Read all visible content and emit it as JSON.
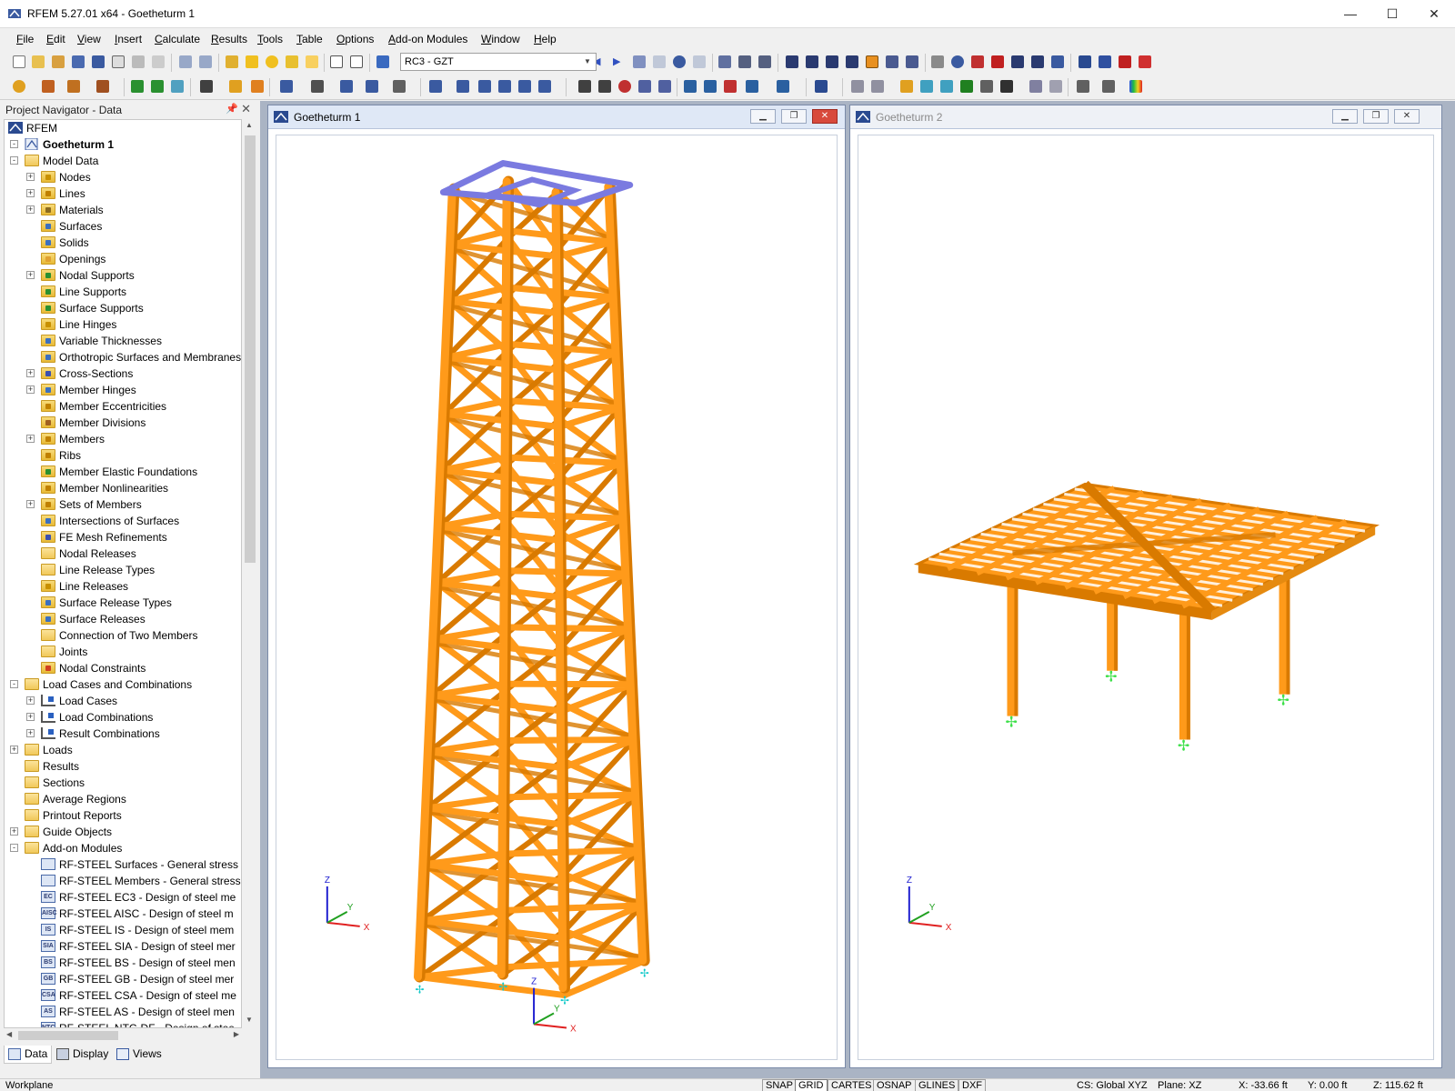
{
  "window": {
    "title": "RFEM 5.27.01 x64 - Goetheturm 1",
    "min_glyph": "—",
    "max_glyph": "☐",
    "close_glyph": "✕"
  },
  "menu": [
    "File",
    "Edit",
    "View",
    "Insert",
    "Calculate",
    "Results",
    "Tools",
    "Table",
    "Options",
    "Add-on Modules",
    "Window",
    "Help"
  ],
  "toolbar": {
    "load_case": "RC3 - GZT"
  },
  "navigator": {
    "title": "Project Navigator - Data",
    "root": "RFEM",
    "project": "Goetheturm 1",
    "items": [
      {
        "label": "Model Data",
        "level": 1,
        "exp": "-",
        "icon": "folder"
      },
      {
        "label": "Nodes",
        "level": 2,
        "exp": "+",
        "icon": "folder",
        "dot": "#c89000"
      },
      {
        "label": "Lines",
        "level": 2,
        "exp": "+",
        "icon": "folder",
        "dot": "#c08000"
      },
      {
        "label": "Materials",
        "level": 2,
        "exp": "+",
        "icon": "folder",
        "dot": "#8a6a20"
      },
      {
        "label": "Surfaces",
        "level": 2,
        "exp": "",
        "icon": "folder",
        "dot": "#3a70c0"
      },
      {
        "label": "Solids",
        "level": 2,
        "exp": "",
        "icon": "folder",
        "dot": "#3a70c0"
      },
      {
        "label": "Openings",
        "level": 2,
        "exp": "",
        "icon": "folder",
        "dot": "#e0a030"
      },
      {
        "label": "Nodal Supports",
        "level": 2,
        "exp": "+",
        "icon": "folder",
        "dot": "#2a9030"
      },
      {
        "label": "Line Supports",
        "level": 2,
        "exp": "",
        "icon": "folder",
        "dot": "#2a9030"
      },
      {
        "label": "Surface Supports",
        "level": 2,
        "exp": "",
        "icon": "folder",
        "dot": "#2a9030"
      },
      {
        "label": "Line Hinges",
        "level": 2,
        "exp": "",
        "icon": "folder",
        "dot": "#c89000"
      },
      {
        "label": "Variable Thicknesses",
        "level": 2,
        "exp": "",
        "icon": "folder",
        "dot": "#3a70c0"
      },
      {
        "label": "Orthotropic Surfaces and Membranes",
        "level": 2,
        "exp": "",
        "icon": "folder",
        "dot": "#3a70c0"
      },
      {
        "label": "Cross-Sections",
        "level": 2,
        "exp": "+",
        "icon": "folder",
        "dot": "#3a50b0"
      },
      {
        "label": "Member Hinges",
        "level": 2,
        "exp": "+",
        "icon": "folder",
        "dot": "#3a70c0"
      },
      {
        "label": "Member Eccentricities",
        "level": 2,
        "exp": "",
        "icon": "folder",
        "dot": "#c08000"
      },
      {
        "label": "Member Divisions",
        "level": 2,
        "exp": "",
        "icon": "folder",
        "dot": "#a06020"
      },
      {
        "label": "Members",
        "level": 2,
        "exp": "+",
        "icon": "folder",
        "dot": "#c08000"
      },
      {
        "label": "Ribs",
        "level": 2,
        "exp": "",
        "icon": "folder",
        "dot": "#c08000"
      },
      {
        "label": "Member Elastic Foundations",
        "level": 2,
        "exp": "",
        "icon": "folder",
        "dot": "#2a9030"
      },
      {
        "label": "Member Nonlinearities",
        "level": 2,
        "exp": "",
        "icon": "folder",
        "dot": "#c08000"
      },
      {
        "label": "Sets of Members",
        "level": 2,
        "exp": "+",
        "icon": "folder",
        "dot": "#c08000"
      },
      {
        "label": "Intersections of Surfaces",
        "level": 2,
        "exp": "",
        "icon": "folder",
        "dot": "#3a70c0"
      },
      {
        "label": "FE Mesh Refinements",
        "level": 2,
        "exp": "",
        "icon": "folder",
        "dot": "#3a50b0"
      },
      {
        "label": "Nodal Releases",
        "level": 2,
        "exp": "",
        "icon": "folder",
        "dot": ""
      },
      {
        "label": "Line Release Types",
        "level": 2,
        "exp": "",
        "icon": "folder",
        "dot": ""
      },
      {
        "label": "Line Releases",
        "level": 2,
        "exp": "",
        "icon": "folder",
        "dot": "#c89000"
      },
      {
        "label": "Surface Release Types",
        "level": 2,
        "exp": "",
        "icon": "folder",
        "dot": "#3a70c0"
      },
      {
        "label": "Surface Releases",
        "level": 2,
        "exp": "",
        "icon": "folder",
        "dot": "#3a70c0"
      },
      {
        "label": "Connection of Two Members",
        "level": 2,
        "exp": "",
        "icon": "folder",
        "dot": ""
      },
      {
        "label": "Joints",
        "level": 2,
        "exp": "",
        "icon": "folder",
        "dot": ""
      },
      {
        "label": "Nodal Constraints",
        "level": 2,
        "exp": "",
        "icon": "folder",
        "dot": "#d04020"
      },
      {
        "label": "Load Cases and Combinations",
        "level": 1,
        "exp": "-",
        "icon": "folder"
      },
      {
        "label": "Load Cases",
        "level": 2,
        "exp": "+",
        "icon": "load",
        "dot": ""
      },
      {
        "label": "Load Combinations",
        "level": 2,
        "exp": "+",
        "icon": "load",
        "dot": ""
      },
      {
        "label": "Result Combinations",
        "level": 2,
        "exp": "+",
        "icon": "load",
        "dot": ""
      },
      {
        "label": "Loads",
        "level": 1,
        "exp": "+",
        "icon": "folder"
      },
      {
        "label": "Results",
        "level": 1,
        "exp": "",
        "icon": "folder"
      },
      {
        "label": "Sections",
        "level": 1,
        "exp": "",
        "icon": "folder"
      },
      {
        "label": "Average Regions",
        "level": 1,
        "exp": "",
        "icon": "folder"
      },
      {
        "label": "Printout Reports",
        "level": 1,
        "exp": "",
        "icon": "folder"
      },
      {
        "label": "Guide Objects",
        "level": 1,
        "exp": "+",
        "icon": "folder"
      },
      {
        "label": "Add-on Modules",
        "level": 1,
        "exp": "-",
        "icon": "folder"
      },
      {
        "label": "RF-STEEL Surfaces - General stress",
        "level": 2,
        "exp": "",
        "icon": "module",
        "badge": ""
      },
      {
        "label": "RF-STEEL Members - General stress",
        "level": 2,
        "exp": "",
        "icon": "module",
        "badge": ""
      },
      {
        "label": "RF-STEEL EC3 - Design of steel me",
        "level": 2,
        "exp": "",
        "icon": "module",
        "badge": "EC"
      },
      {
        "label": "RF-STEEL AISC - Design of steel m",
        "level": 2,
        "exp": "",
        "icon": "module",
        "badge": "AISC"
      },
      {
        "label": "RF-STEEL IS - Design of steel mem",
        "level": 2,
        "exp": "",
        "icon": "module",
        "badge": "IS"
      },
      {
        "label": "RF-STEEL SIA - Design of steel mer",
        "level": 2,
        "exp": "",
        "icon": "module",
        "badge": "SIA"
      },
      {
        "label": "RF-STEEL BS - Design of steel men",
        "level": 2,
        "exp": "",
        "icon": "module",
        "badge": "BS"
      },
      {
        "label": "RF-STEEL GB - Design of steel mer",
        "level": 2,
        "exp": "",
        "icon": "module",
        "badge": "GB"
      },
      {
        "label": "RF-STEEL CSA - Design of steel me",
        "level": 2,
        "exp": "",
        "icon": "module",
        "badge": "CSA"
      },
      {
        "label": "RF-STEEL AS - Design of steel men",
        "level": 2,
        "exp": "",
        "icon": "module",
        "badge": "AS"
      },
      {
        "label": "RF-STEEL NTC-DF - Design of stee",
        "level": 2,
        "exp": "",
        "icon": "module",
        "badge": "NTC"
      }
    ],
    "tabs": [
      "Data",
      "Display",
      "Views"
    ]
  },
  "views": [
    {
      "title": "Goetheturm 1",
      "active": true
    },
    {
      "title": "Goetheturm 2",
      "active": false
    }
  ],
  "axes": {
    "x": "X",
    "y": "Y",
    "z": "Z"
  },
  "statusbar": {
    "workplane": "Workplane",
    "toggles": [
      "SNAP",
      "GRID",
      "CARTES",
      "OSNAP",
      "GLINES",
      "DXF"
    ],
    "active_toggle": "GRID",
    "cs": "CS: Global XYZ",
    "plane": "Plane: XZ",
    "x": "X:  -33.66 ft",
    "y": "Y:   0.00 ft",
    "z": "Z:  115.62 ft"
  },
  "colors": {
    "member": "#ff9a1a",
    "member_dark": "#d97a00",
    "slab": "#7a7ae0",
    "support": "#3ee04a",
    "axis_x": "#e02020",
    "axis_y": "#20a020",
    "axis_z": "#2020d0"
  }
}
